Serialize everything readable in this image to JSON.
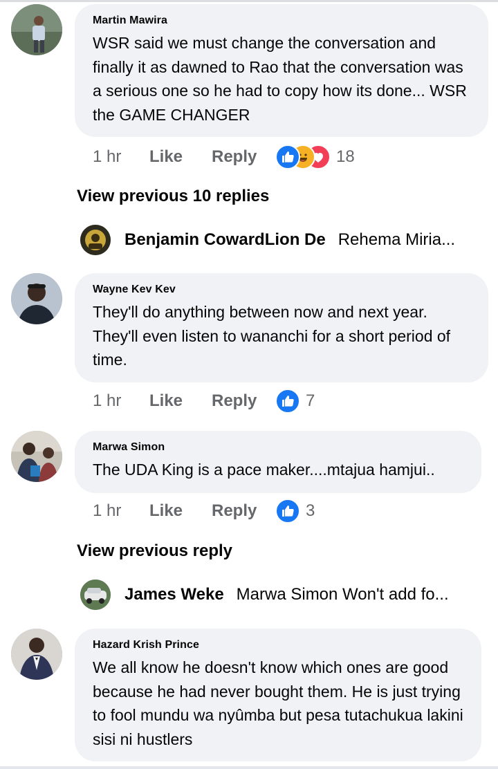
{
  "comments": [
    {
      "author": "Martin Mawira",
      "text": "WSR said we must change the conversation and finally it as dawned to Rao that the conversation was a serious one so he had to copy how its done... WSR the GAME CHANGER",
      "time": "1 hr",
      "like_label": "Like",
      "reply_label": "Reply",
      "reactions": [
        "like-icon",
        "haha-icon",
        "love-icon"
      ],
      "reaction_count": "18"
    },
    {
      "author": "Wayne Kev Kev",
      "text": "They'll do anything between now and next year. They'll even listen to wananchi for a short period of time.",
      "time": "1 hr",
      "like_label": "Like",
      "reply_label": "Reply",
      "reactions": [
        "like-icon"
      ],
      "reaction_count": "7"
    },
    {
      "author": "Marwa Simon",
      "text": "The UDA King is a pace maker....mtajua hamjui..",
      "time": "1 hr",
      "like_label": "Like",
      "reply_label": "Reply",
      "reactions": [
        "like-icon"
      ],
      "reaction_count": "3"
    },
    {
      "author": "Hazard Krish Prince",
      "text": "We all know he doesn't know which ones are good because he had never bought them. He is just trying to fool mundu wa nyûmba but pesa tutachukua lakini sisi ni hustlers"
    }
  ],
  "view_previous": [
    "View previous 10 replies",
    "View previous reply"
  ],
  "collapsed_replies": [
    {
      "name": "Benjamin CowardLion De",
      "preview": "Rehema Miria..."
    },
    {
      "name": "James Weke",
      "preview": "Marwa Simon Won't add fo..."
    }
  ],
  "colors": {
    "like": "#1877f2",
    "haha": "#f7b125",
    "love": "#f33e58",
    "bubble": "#f0f2f5",
    "meta_text": "#65676b"
  }
}
